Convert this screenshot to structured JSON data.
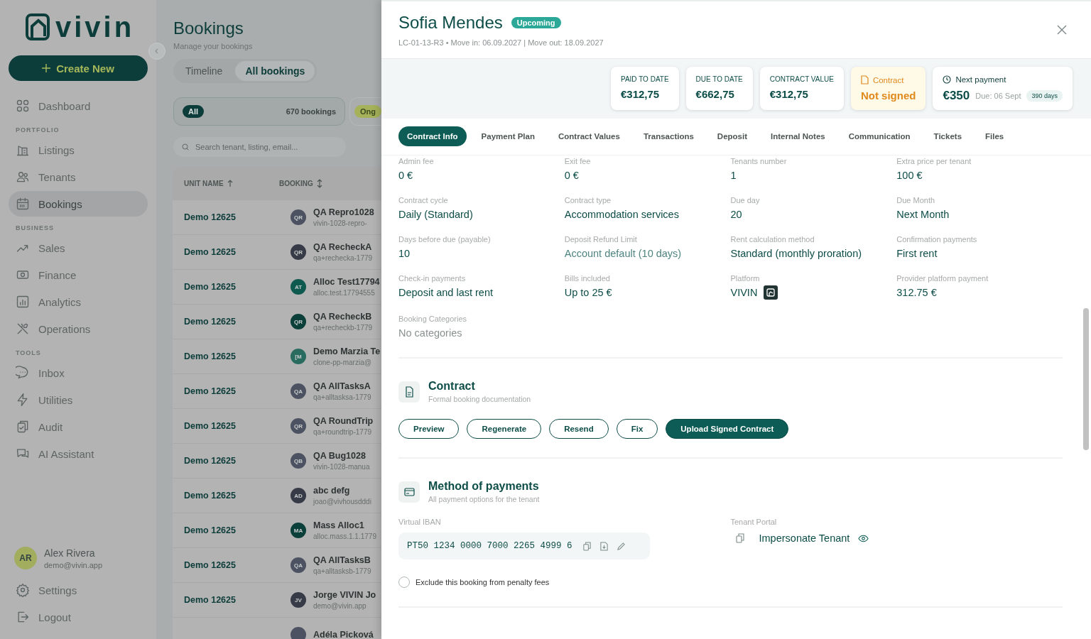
{
  "sidebar": {
    "logo": "vivin",
    "create_button": "Create New",
    "sections": [
      {
        "items": [
          {
            "label": "Dashboard",
            "kind": "dashboard",
            "selected": false
          }
        ]
      },
      {
        "heading": "PORTFOLIO",
        "items": [
          {
            "label": "Listings",
            "kind": "listings",
            "selected": false
          },
          {
            "label": "Tenants",
            "kind": "tenants",
            "selected": false
          },
          {
            "label": "Bookings",
            "kind": "bookings",
            "selected": true
          }
        ]
      },
      {
        "heading": "BUSINESS",
        "items": [
          {
            "label": "Sales",
            "kind": "sales",
            "selected": false
          },
          {
            "label": "Finance",
            "kind": "finance",
            "selected": false
          },
          {
            "label": "Analytics",
            "kind": "analytics",
            "selected": false
          },
          {
            "label": "Operations",
            "kind": "operations",
            "selected": false
          }
        ]
      },
      {
        "heading": "TOOLS",
        "items": [
          {
            "label": "Inbox",
            "kind": "inbox",
            "selected": false
          },
          {
            "label": "Utilities",
            "kind": "utilities",
            "selected": false
          },
          {
            "label": "Audit",
            "kind": "audit",
            "selected": false
          },
          {
            "label": "AI Assistant",
            "kind": "assistant",
            "selected": false
          }
        ]
      }
    ],
    "user": {
      "initials": "AR",
      "name": "Alex Rivera",
      "email": "demo@vivin.app"
    },
    "footer": [
      {
        "label": "Settings",
        "kind": "settings"
      },
      {
        "label": "Logout",
        "kind": "logout"
      }
    ]
  },
  "page": {
    "title": "Bookings",
    "subtitle": "Manage your bookings",
    "views": [
      {
        "label": "Timeline",
        "selected": false
      },
      {
        "label": "All bookings",
        "selected": true
      }
    ],
    "filters": [
      {
        "chip": "All",
        "count": "670 bookings",
        "selected": true
      },
      {
        "chip": "Ong",
        "selected": false
      }
    ],
    "search": {
      "placeholder": "Search tenant, listing, email..."
    },
    "columns": [
      "UNIT NAME",
      "BOOKING"
    ],
    "rows": [
      {
        "unit": "Demo 12625",
        "initials": "QR",
        "color": "#4c5261",
        "name": "QA Repro1028",
        "email": "vivin-1028-repro-"
      },
      {
        "unit": "Demo 12625",
        "initials": "QR",
        "color": "#363b47",
        "name": "QA RecheckA",
        "email": "qa+rechecka-1779"
      },
      {
        "unit": "Demo 12625",
        "initials": "AT",
        "color": "#0e5a4e",
        "name": "Alloc Test17794",
        "email": "alloc.test.17794555"
      },
      {
        "unit": "Demo 12625",
        "initials": "QR",
        "color": "#0a3f3a",
        "name": "QA RecheckB",
        "email": "qa+recheckb-1779"
      },
      {
        "unit": "Demo 12625",
        "initials": "[M",
        "color": "#2a6b60",
        "name": "Demo Marzia Te",
        "email": "clone-pp-marzia@"
      },
      {
        "unit": "Demo 12625",
        "initials": "QA",
        "color": "#4c5261",
        "name": "QA AllTasksA",
        "email": "qa+alltasksa-1779"
      },
      {
        "unit": "Demo 12625",
        "initials": "QR",
        "color": "#4c5261",
        "name": "QA RoundTrip",
        "email": "qa+roundtrip-1779"
      },
      {
        "unit": "Demo 12625",
        "initials": "QB",
        "color": "#4c5261",
        "name": "QA Bug1028",
        "email": "vivin-1028-manua"
      },
      {
        "unit": "Demo 12625",
        "initials": "AD",
        "color": "#363b47",
        "name": "abc defg",
        "email": "joao@vivhousdddi"
      },
      {
        "unit": "Demo 12625",
        "initials": "MA",
        "color": "#0a3f3a",
        "name": "Mass Alloc1",
        "email": "alloc.mass.1.1.1779"
      },
      {
        "unit": "Demo 12625",
        "initials": "QA",
        "color": "#4c5261",
        "name": "QA AllTasksB",
        "email": "qa+alltasksb-1779"
      },
      {
        "unit": "Demo 12625",
        "initials": "JV",
        "color": "#363b47",
        "name": "Jorge VIVIN Jo",
        "email": "demo@vivin.app"
      },
      {
        "name": "Adéla Picková",
        "color": "#4c5261"
      }
    ]
  },
  "drawer": {
    "name": "Sofia Mendes",
    "status": "Upcoming",
    "subtitle": "LC-01-13-R3 • Move in: 06.09.2027 | Move out: 18.09.2027",
    "stats": [
      {
        "kind": "amount",
        "label": "PAID TO DATE",
        "value": "€312,75"
      },
      {
        "kind": "amount",
        "label": "DUE TO DATE",
        "value": "€662,75"
      },
      {
        "kind": "amount",
        "label": "CONTRACT VALUE",
        "value": "€312,75"
      },
      {
        "kind": "contract",
        "label": "Contract",
        "value": "Not signed"
      },
      {
        "kind": "next",
        "label": "Next payment",
        "value": "€350",
        "due": "Due: 06 Sept",
        "days": "390 days"
      }
    ],
    "tabs": [
      {
        "label": "Contract Info",
        "selected": true
      },
      {
        "label": "Payment Plan",
        "selected": false
      },
      {
        "label": "Contract Values",
        "selected": false
      },
      {
        "label": "Transactions",
        "selected": false
      },
      {
        "label": "Deposit",
        "selected": false
      },
      {
        "label": "Internal Notes",
        "selected": false
      },
      {
        "label": "Communication",
        "selected": false
      },
      {
        "label": "Tickets",
        "selected": false
      },
      {
        "label": "Files",
        "selected": false
      }
    ],
    "fields": [
      {
        "label": "Admin fee",
        "value": "0 €",
        "kind": "text"
      },
      {
        "label": "Exit fee",
        "value": "0 €",
        "kind": "text"
      },
      {
        "label": "Tenants number",
        "value": "1",
        "kind": "text"
      },
      {
        "label": "Extra price per tenant",
        "value": "100 €",
        "kind": "text"
      },
      {
        "label": "Contract cycle",
        "value": "Daily (Standard)",
        "kind": "text"
      },
      {
        "label": "Contract type",
        "value": "Accommodation services",
        "kind": "text"
      },
      {
        "label": "Due day",
        "value": "20",
        "kind": "text"
      },
      {
        "label": "Due Month",
        "value": "Next Month",
        "kind": "text"
      },
      {
        "label": "Days before due (payable)",
        "value": "10",
        "kind": "text"
      },
      {
        "label": "Deposit Refund Limit",
        "value": "Account default (10 days)",
        "kind": "default"
      },
      {
        "label": "Rent calculation method",
        "value": "Standard (monthly proration)",
        "kind": "text"
      },
      {
        "label": "Confirmation payments",
        "value": "First rent",
        "kind": "text"
      },
      {
        "label": "Check-in payments",
        "value": "Deposit and last rent",
        "kind": "text"
      },
      {
        "label": "Bills included",
        "value": "Up to 25 €",
        "kind": "text"
      },
      {
        "label": "Platform",
        "value": "VIVIN",
        "kind": "platform"
      },
      {
        "label": "Provider platform payment",
        "value": "312.75 €",
        "kind": "text"
      },
      {
        "label": "Booking Categories",
        "value": "No categories",
        "kind": "empty"
      }
    ],
    "contract": {
      "title": "Contract",
      "subtitle": "Formal booking documentation",
      "buttons": [
        {
          "label": "Preview",
          "primary": false
        },
        {
          "label": "Regenerate",
          "primary": false
        },
        {
          "label": "Resend",
          "primary": false
        },
        {
          "label": "Fix",
          "primary": false
        },
        {
          "label": "Upload Signed Contract",
          "primary": true
        }
      ]
    },
    "payments": {
      "title": "Method of payments",
      "subtitle": "All payment options for the tenant",
      "iban_label": "Virtual IBAN",
      "iban": "PT50 1234 0000 7000 2265 4999 6",
      "portal_label": "Tenant Portal",
      "portal_link": "Impersonate Tenant",
      "penalty": {
        "label": "Exclude this booking from penalty fees",
        "checked": false
      }
    }
  }
}
